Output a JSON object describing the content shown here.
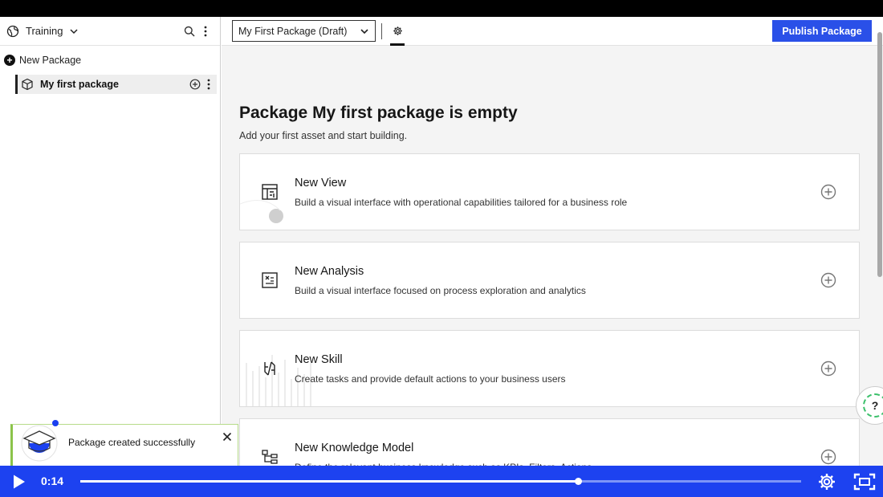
{
  "sidebar": {
    "workspace_name": "Training",
    "new_package_label": "New Package",
    "packages": [
      {
        "label": "My first package"
      }
    ]
  },
  "topbar": {
    "package_select_value": "My First Package (Draft)",
    "publish_label": "Publish Package"
  },
  "main": {
    "empty_title": "Package My first package is empty",
    "empty_subtitle": "Add your first asset and start building.",
    "cards": [
      {
        "title": "New View",
        "description": "Build a visual interface with operational capabilities tailored for a business role",
        "icon": "view-icon"
      },
      {
        "title": "New Analysis",
        "description": "Build a visual interface focused on process exploration and analytics",
        "icon": "analysis-icon"
      },
      {
        "title": "New Skill",
        "description": "Create tasks and provide default actions to your business users",
        "icon": "skill-icon"
      },
      {
        "title": "New Knowledge Model",
        "description": "Define the relevant business knowledge such as KPIs, Filters, Actions",
        "icon": "knowledge-model-icon"
      }
    ]
  },
  "toast": {
    "message": "Package created successfully"
  },
  "help": {
    "label": "?"
  },
  "video": {
    "time": "0:14",
    "progress_percent": 69
  },
  "colors": {
    "accent": "#2a50e8",
    "video_bar": "#1d42f0",
    "toast_border": "#8bc34a"
  }
}
